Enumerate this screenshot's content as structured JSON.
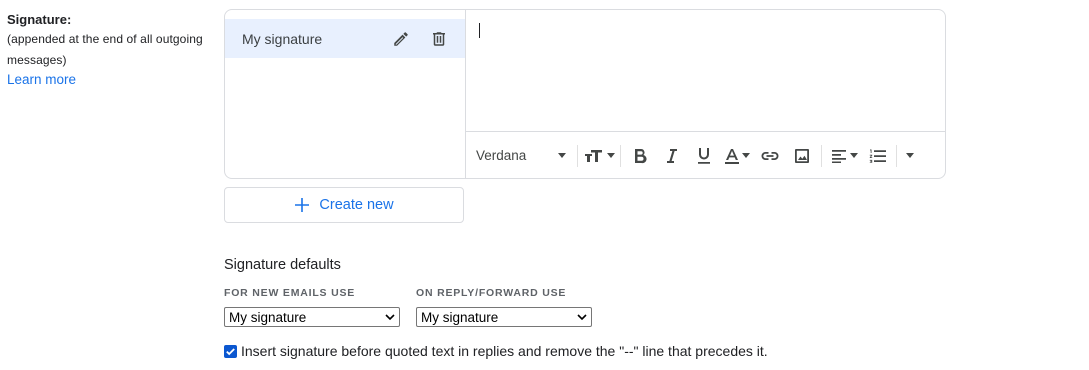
{
  "signature_section": {
    "title": "Signature:",
    "description": "(appended at the end of all outgoing messages)",
    "learn_more": "Learn more"
  },
  "signature_list": {
    "items": [
      {
        "name": "My signature",
        "selected": true
      }
    ]
  },
  "editor": {
    "content": ""
  },
  "toolbar": {
    "font": "Verdana",
    "buttons": [
      "font-size-icon",
      "bold-icon",
      "italic-icon",
      "underline-icon",
      "text-color-icon",
      "link-icon",
      "image-icon",
      "align-icon",
      "numbered-list-icon",
      "more-options-icon"
    ]
  },
  "create_new": {
    "label": "Create new"
  },
  "defaults": {
    "title": "Signature defaults",
    "new_emails_label": "FOR NEW EMAILS USE",
    "new_emails_value": "My signature",
    "reply_label": "ON REPLY/FORWARD USE",
    "reply_value": "My signature"
  },
  "insert_option": {
    "checked": true,
    "label": "Insert signature before quoted text in replies and remove the \"--\" line that precedes it."
  },
  "colors": {
    "accent": "#1a73e8",
    "selected_bg": "#e8f0fe",
    "border": "#dadce0",
    "checkbox": "#0b57d0"
  }
}
